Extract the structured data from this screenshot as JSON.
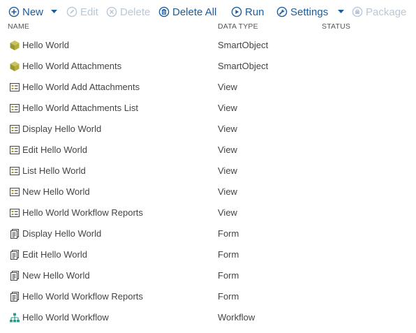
{
  "colors": {
    "accent": "#1a5c9e",
    "disabled": "#b9c7d6",
    "text": "#444444",
    "smartobject_icon": "#a8a232",
    "workflow_icon": "#2e9c8c"
  },
  "toolbar": {
    "new_label": "New",
    "edit_label": "Edit",
    "delete_label": "Delete",
    "delete_all_label": "Delete All",
    "run_label": "Run",
    "settings_label": "Settings",
    "package_label": "Package"
  },
  "table": {
    "columns": {
      "name": "NAME",
      "data_type": "DATA TYPE",
      "status": "STATUS"
    },
    "rows": [
      {
        "name": "Hello World",
        "type": "SmartObject",
        "icon": "smartobject-icon",
        "status": ""
      },
      {
        "name": "Hello World Attachments",
        "type": "SmartObject",
        "icon": "smartobject-icon",
        "status": ""
      },
      {
        "name": "Hello World Add Attachments",
        "type": "View",
        "icon": "view-icon",
        "status": ""
      },
      {
        "name": "Hello World Attachments List",
        "type": "View",
        "icon": "view-icon",
        "status": ""
      },
      {
        "name": "Display Hello World",
        "type": "View",
        "icon": "view-icon",
        "status": ""
      },
      {
        "name": "Edit Hello World",
        "type": "View",
        "icon": "view-icon",
        "status": ""
      },
      {
        "name": "List Hello World",
        "type": "View",
        "icon": "view-icon",
        "status": ""
      },
      {
        "name": "New Hello World",
        "type": "View",
        "icon": "view-icon",
        "status": ""
      },
      {
        "name": "Hello World Workflow Reports",
        "type": "View",
        "icon": "view-icon",
        "status": ""
      },
      {
        "name": "Display Hello World",
        "type": "Form",
        "icon": "form-icon",
        "status": ""
      },
      {
        "name": "Edit Hello World",
        "type": "Form",
        "icon": "form-icon",
        "status": ""
      },
      {
        "name": "New Hello World",
        "type": "Form",
        "icon": "form-icon",
        "status": ""
      },
      {
        "name": "Hello World Workflow Reports",
        "type": "Form",
        "icon": "form-icon",
        "status": ""
      },
      {
        "name": "Hello World Workflow",
        "type": "Workflow",
        "icon": "workflow-icon",
        "status": ""
      }
    ]
  }
}
